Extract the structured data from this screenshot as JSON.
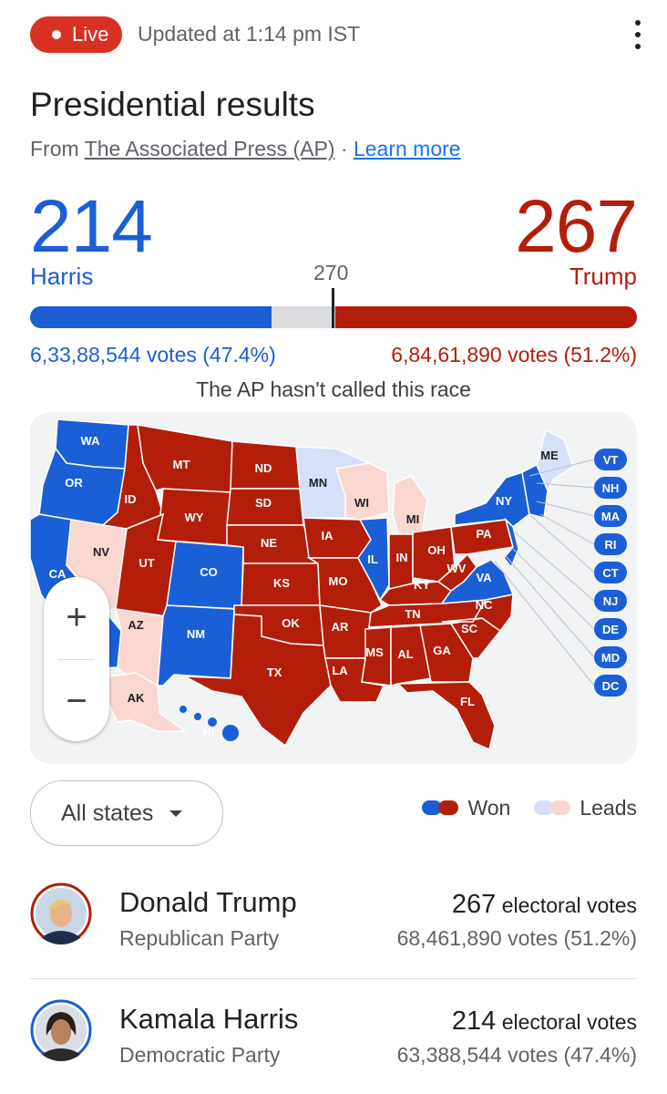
{
  "header": {
    "live_label": "Live",
    "updated_text": "Updated at 1:14 pm IST"
  },
  "title": "Presidential results",
  "source": {
    "prefix": "From",
    "name": "The Associated Press (AP)",
    "separator": "·",
    "learn_more": "Learn more"
  },
  "tally": {
    "harris": {
      "electoral_votes": "214",
      "name": "Harris",
      "votes_text": "6,33,88,544 votes (47.4%)",
      "ev_fraction": 0.3981
    },
    "trump": {
      "electoral_votes": "267",
      "name": "Trump",
      "votes_text": "6,84,61,890 votes (51.2%)",
      "ev_fraction": 0.4963
    },
    "threshold_label": "270",
    "status": "The AP hasn't called this race"
  },
  "colors": {
    "dem_won": "#1a5fd6",
    "rep_won": "#b31e0a",
    "dem_lead": "#d7e0f9",
    "rep_lead": "#fbd7d2"
  },
  "map": {
    "states": [
      {
        "abbr": "WA",
        "status": "dem_won"
      },
      {
        "abbr": "OR",
        "status": "dem_won"
      },
      {
        "abbr": "CA",
        "status": "dem_won"
      },
      {
        "abbr": "NV",
        "status": "rep_lead"
      },
      {
        "abbr": "AZ",
        "status": "rep_lead"
      },
      {
        "abbr": "AK",
        "status": "rep_lead"
      },
      {
        "abbr": "HI",
        "status": "dem_won"
      },
      {
        "abbr": "MT",
        "status": "rep_won"
      },
      {
        "abbr": "ID",
        "status": "rep_won"
      },
      {
        "abbr": "WY",
        "status": "rep_won"
      },
      {
        "abbr": "UT",
        "status": "rep_won"
      },
      {
        "abbr": "CO",
        "status": "dem_won"
      },
      {
        "abbr": "NM",
        "status": "dem_won"
      },
      {
        "abbr": "ND",
        "status": "rep_won"
      },
      {
        "abbr": "SD",
        "status": "rep_won"
      },
      {
        "abbr": "NE",
        "status": "rep_won"
      },
      {
        "abbr": "KS",
        "status": "rep_won"
      },
      {
        "abbr": "OK",
        "status": "rep_won"
      },
      {
        "abbr": "TX",
        "status": "rep_won"
      },
      {
        "abbr": "MN",
        "status": "dem_lead"
      },
      {
        "abbr": "IA",
        "status": "rep_won"
      },
      {
        "abbr": "MO",
        "status": "rep_won"
      },
      {
        "abbr": "AR",
        "status": "rep_won"
      },
      {
        "abbr": "LA",
        "status": "rep_won"
      },
      {
        "abbr": "WI",
        "status": "rep_lead"
      },
      {
        "abbr": "IL",
        "status": "dem_won"
      },
      {
        "abbr": "MI",
        "status": "rep_lead"
      },
      {
        "abbr": "IN",
        "status": "rep_won"
      },
      {
        "abbr": "OH",
        "status": "rep_won"
      },
      {
        "abbr": "KY",
        "status": "rep_won"
      },
      {
        "abbr": "TN",
        "status": "rep_won"
      },
      {
        "abbr": "MS",
        "status": "rep_won"
      },
      {
        "abbr": "AL",
        "status": "rep_won"
      },
      {
        "abbr": "GA",
        "status": "rep_won"
      },
      {
        "abbr": "FL",
        "status": "rep_won"
      },
      {
        "abbr": "SC",
        "status": "rep_won"
      },
      {
        "abbr": "NC",
        "status": "rep_won"
      },
      {
        "abbr": "VA",
        "status": "dem_won"
      },
      {
        "abbr": "WV",
        "status": "rep_won"
      },
      {
        "abbr": "PA",
        "status": "rep_won"
      },
      {
        "abbr": "NY",
        "status": "dem_won"
      },
      {
        "abbr": "ME",
        "status": "dem_lead"
      }
    ],
    "small_state_badges": [
      "VT",
      "NH",
      "MA",
      "RI",
      "CT",
      "NJ",
      "DE",
      "MD",
      "DC"
    ],
    "zoom_in_label": "+",
    "zoom_out_label": "−"
  },
  "filter": {
    "label": "All states"
  },
  "legend": {
    "won_label": "Won",
    "leads_label": "Leads"
  },
  "candidates": [
    {
      "name": "Donald Trump",
      "party": "Republican Party",
      "electoral_votes": "267",
      "ev_suffix": "electoral votes",
      "votes_text": "68,461,890 votes (51.2%)"
    },
    {
      "name": "Kamala Harris",
      "party": "Democratic Party",
      "electoral_votes": "214",
      "ev_suffix": "electoral votes",
      "votes_text": "63,388,544 votes (47.4%)"
    }
  ]
}
